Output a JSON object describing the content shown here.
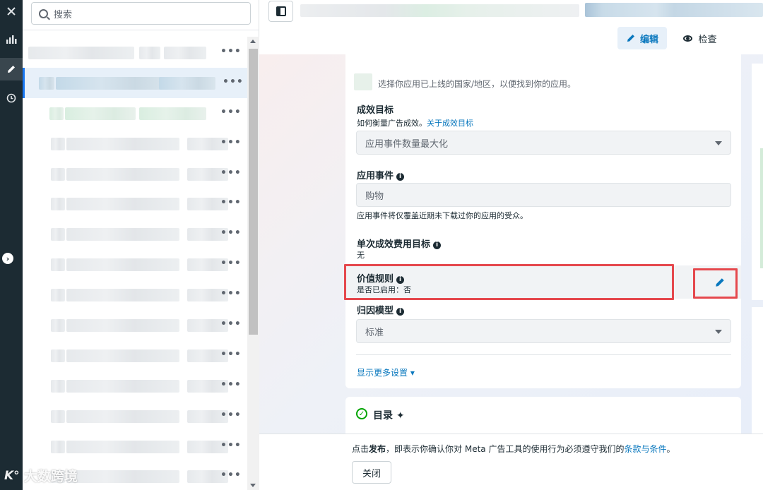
{
  "search": {
    "placeholder": "搜索"
  },
  "tree": {
    "row_menu": "•••",
    "rows": [
      {
        "variant": "plain"
      },
      {
        "variant": "selected"
      },
      {
        "variant": "green"
      },
      {
        "variant": "plain"
      },
      {
        "variant": "plain"
      },
      {
        "variant": "plain"
      },
      {
        "variant": "plain"
      },
      {
        "variant": "plain"
      },
      {
        "variant": "plain"
      },
      {
        "variant": "plain"
      },
      {
        "variant": "plain"
      },
      {
        "variant": "plain"
      },
      {
        "variant": "plain"
      },
      {
        "variant": "plain"
      },
      {
        "variant": "plain"
      }
    ]
  },
  "header": {
    "edit_label": "编辑",
    "view_label": "检查"
  },
  "form": {
    "location_hint": "选择你应用已上线的国家/地区，以便找到你的应用。",
    "performance_goal": {
      "label": "成效目标",
      "desc": "如何衡量广告成效。",
      "link": "关于成效目标",
      "value": "应用事件数量最大化"
    },
    "app_event": {
      "label": "应用事件",
      "value": "购物",
      "helper": "应用事件将仅覆盖近期未下载过你的应用的受众。"
    },
    "cost_per_result": {
      "label": "单次成效费用目标",
      "value": "无"
    },
    "value_rules": {
      "label": "价值规则",
      "status": "是否已启用：否"
    },
    "attribution": {
      "label": "归因模型",
      "value": "标准"
    },
    "more_settings": "显示更多设置"
  },
  "catalog": {
    "title": "目录"
  },
  "footer": {
    "notice_prefix": "点击",
    "notice_bold": "发布",
    "notice_mid": "，即表示你确认你对 Meta 广告工具的使用行为必须遵守我们的",
    "notice_link": "条款与条件",
    "notice_end": "。",
    "close_label": "关闭"
  },
  "watermark": {
    "text": "大数跨境",
    "mark": "K°"
  },
  "colors": {
    "accent": "#0a78be",
    "highlight": "#e5484d",
    "rail": "#1c2b33"
  }
}
